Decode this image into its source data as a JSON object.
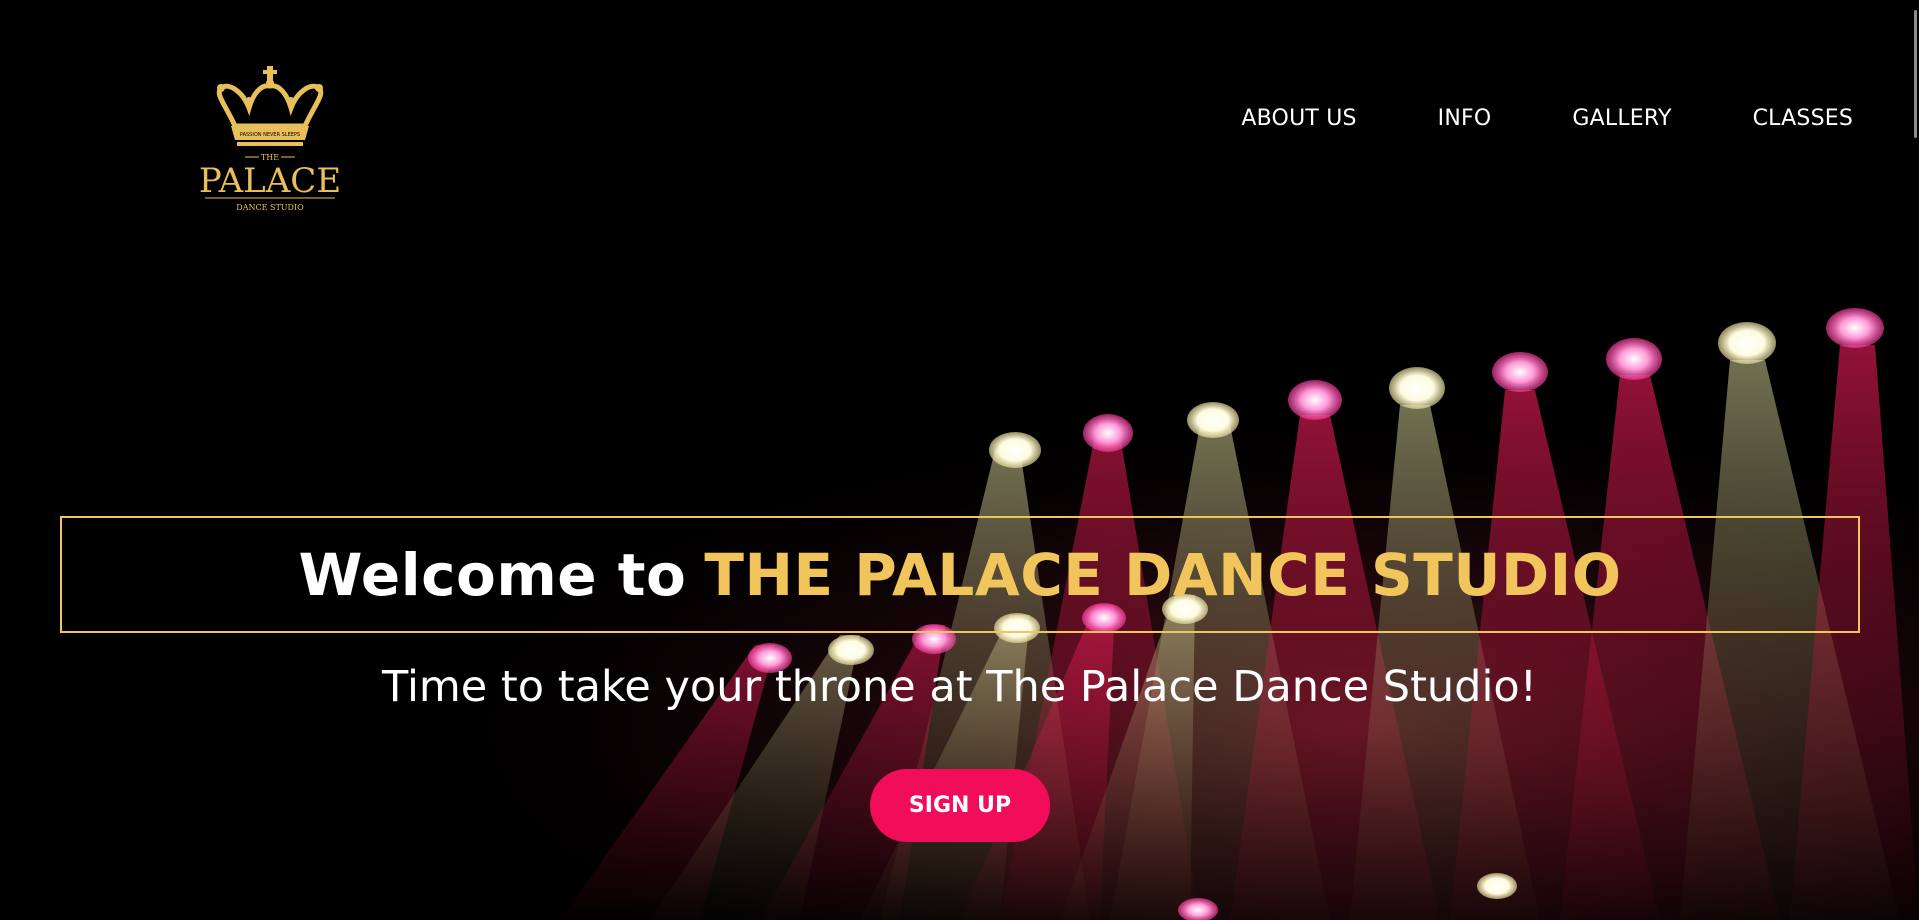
{
  "brand": {
    "logo_name": "crown-logo",
    "logo_tagline": "PASSION NEVER SLEEPS",
    "logo_the": "THE",
    "logo_palace": "PALACE",
    "logo_sub": "DANCE STUDIO"
  },
  "nav": {
    "items": [
      {
        "label": "ABOUT US"
      },
      {
        "label": "INFO"
      },
      {
        "label": "GALLERY"
      },
      {
        "label": "CLASSES"
      }
    ]
  },
  "hero": {
    "welcome_prefix": "Welcome to",
    "welcome_name": "THE PALACE DANCE STUDIO",
    "tagline": "Time to take your throne at The Palace Dance Studio!",
    "cta_label": "SIGN UP"
  },
  "colors": {
    "gold": "#f1c45c",
    "pink": "#f20d5a",
    "background": "#000000"
  }
}
